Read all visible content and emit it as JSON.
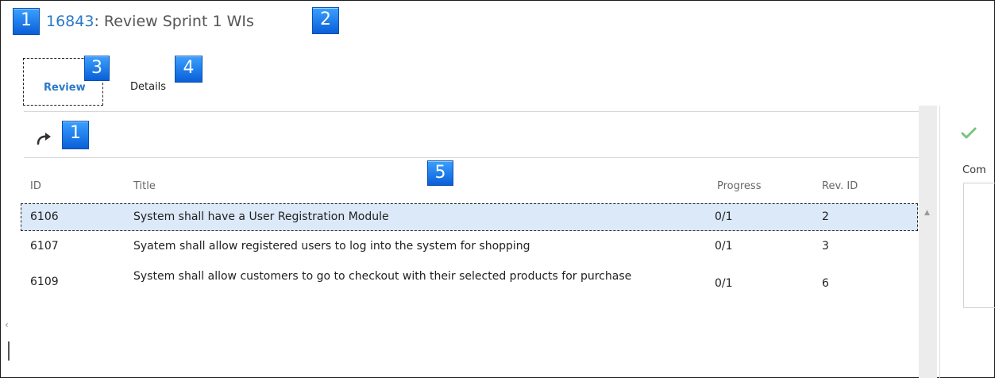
{
  "header": {
    "item_id": "16843",
    "item_title": ": Review Sprint 1 WIs"
  },
  "tabs": [
    {
      "label": "Review",
      "active": true
    },
    {
      "label": "Details",
      "active": false
    }
  ],
  "markers": {
    "title_start": "1",
    "title_end": "2",
    "tab_review": "3",
    "tab_details": "4",
    "toolbar": "1",
    "table": "5"
  },
  "toolbar": {
    "icon": "redo-icon"
  },
  "table": {
    "columns": [
      "ID",
      "Title",
      "Progress",
      "Rev. ID"
    ],
    "rows": [
      {
        "id": "6106",
        "title": "System shall have a User Registration Module",
        "progress": "0/1",
        "rev": "2",
        "selected": true
      },
      {
        "id": "6107",
        "title": "Syatem shall allow registered users to log into the system for shopping",
        "progress": "0/1",
        "rev": "3",
        "selected": false
      },
      {
        "id": "6109",
        "title": "System shall allow customers to go to checkout with their selected products for purchase",
        "progress": "0/1",
        "rev": "6",
        "selected": false
      }
    ]
  },
  "right_panel": {
    "check_icon": "check-icon",
    "comment_label": "Com"
  },
  "colors": {
    "accent": "#2b7ac8",
    "selection": "#dbe9f8",
    "check": "#7bc47f",
    "marker": "#1f7ae6"
  }
}
